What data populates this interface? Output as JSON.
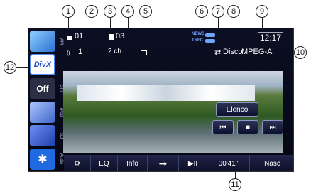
{
  "callouts": [
    "1",
    "2",
    "3",
    "4",
    "5",
    "6",
    "7",
    "8",
    "9",
    "10",
    "11",
    "12"
  ],
  "status": {
    "folder_num": "01",
    "file_num": "03",
    "audio_track": "1",
    "channels": "2 ch",
    "news_label": "NEWS",
    "trfc_label": "TRFC",
    "repeat_mode": "Disco",
    "clock": "12:17",
    "audio_format": "MPEG-A"
  },
  "sidebar": {
    "items": [
      {
        "label": "AM"
      },
      {
        "label": "DivX"
      },
      {
        "label": "OFF",
        "button_text": "Off"
      },
      {
        "label": "iPod"
      },
      {
        "label": "SD"
      },
      {
        "label": "Audio"
      }
    ]
  },
  "video": {
    "chapter_button": "Elenco"
  },
  "bottombar": {
    "eq": "EQ",
    "info": "Info",
    "time": "00'41\"",
    "hide": "Nasc"
  },
  "colors": {
    "screen_bg": "#0b0e21",
    "accent": "#4f8df2",
    "divx_bg": "#ffffff"
  }
}
